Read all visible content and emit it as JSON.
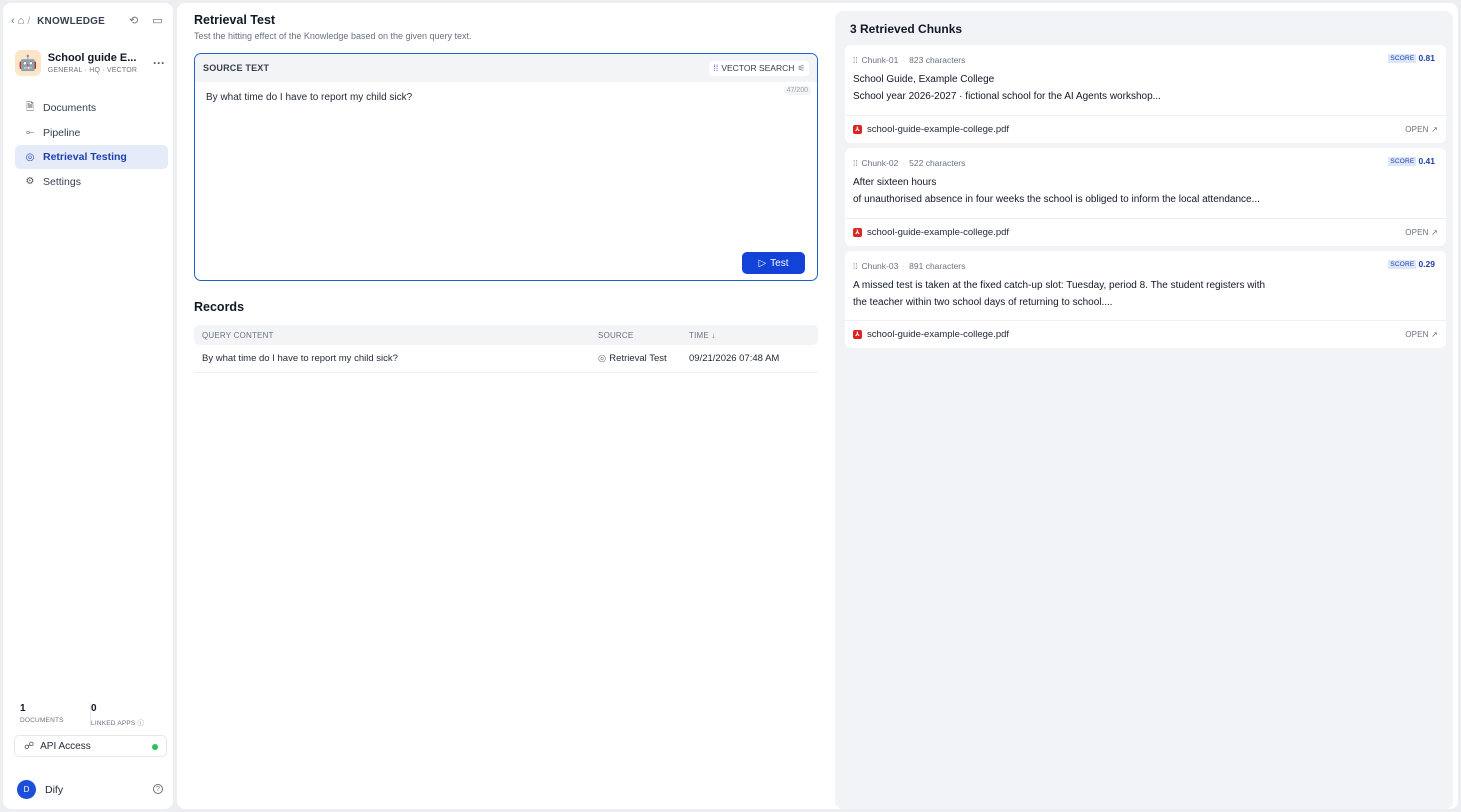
{
  "breadcrumb": {
    "section": "KNOWLEDGE"
  },
  "knowledge": {
    "icon": "🤖",
    "name": "School guide E...",
    "meta": "GENERAL · HQ · VECTOR"
  },
  "nav": [
    {
      "label": "Documents",
      "icon": "document-icon",
      "glyph": "🗎"
    },
    {
      "label": "Pipeline",
      "icon": "pipeline-icon",
      "glyph": "⟜"
    },
    {
      "label": "Retrieval Testing",
      "icon": "target-icon",
      "glyph": "◎",
      "active": true
    },
    {
      "label": "Settings",
      "icon": "settings-icon",
      "glyph": "⚙"
    }
  ],
  "stats": {
    "documents_count": "1",
    "documents_label": "DOCUMENTS",
    "apps_count": "0",
    "apps_label": "LINKED APPS ⓘ"
  },
  "api": {
    "label": "API Access"
  },
  "user": {
    "initial": "D",
    "name": "Dify"
  },
  "header": {
    "title": "Retrieval Test",
    "description": "Test the hitting effect of the Knowledge based on the given query text."
  },
  "query": {
    "title": "SOURCE TEXT",
    "mode": "VECTOR SEARCH",
    "count": "47/200",
    "text": "By what time do I have to report my child sick?",
    "button": "Test"
  },
  "records": {
    "title": "Records",
    "headers": [
      "QUERY CONTENT",
      "SOURCE",
      "TIME ↓"
    ],
    "rows": [
      {
        "query": "By what time do I have to report my child sick?",
        "source": "Retrieval Test",
        "time": "09/21/2026 07:48 AM"
      }
    ]
  },
  "results": {
    "title": "3 Retrieved Chunks",
    "score_label": "SCORE",
    "open_label": "OPEN ↗",
    "chunks": [
      {
        "id": "Chunk-01",
        "chars": "823 characters",
        "score": "0.81",
        "line1": "School Guide, Example College",
        "line2": "School year 2026-2027 · fictional school for the AI Agents workshop...",
        "file": "school-guide-example-college.pdf"
      },
      {
        "id": "Chunk-02",
        "chars": "522 characters",
        "score": "0.41",
        "line1": "After sixteen hours",
        "line2": "of unauthorised absence in four weeks the school is obliged to inform the local attendance...",
        "file": "school-guide-example-college.pdf"
      },
      {
        "id": "Chunk-03",
        "chars": "891 characters",
        "score": "0.29",
        "line1": "A missed test is taken at the fixed catch-up slot: Tuesday, period 8. The student registers with",
        "line2": "the teacher within two school days of returning to school....",
        "file": "school-guide-example-college.pdf"
      }
    ]
  },
  "colors": {
    "accent": "#1242d8",
    "active_bg": "#e6ebfa",
    "status_green": "#22c55e",
    "pdf_red": "#dc2626"
  }
}
